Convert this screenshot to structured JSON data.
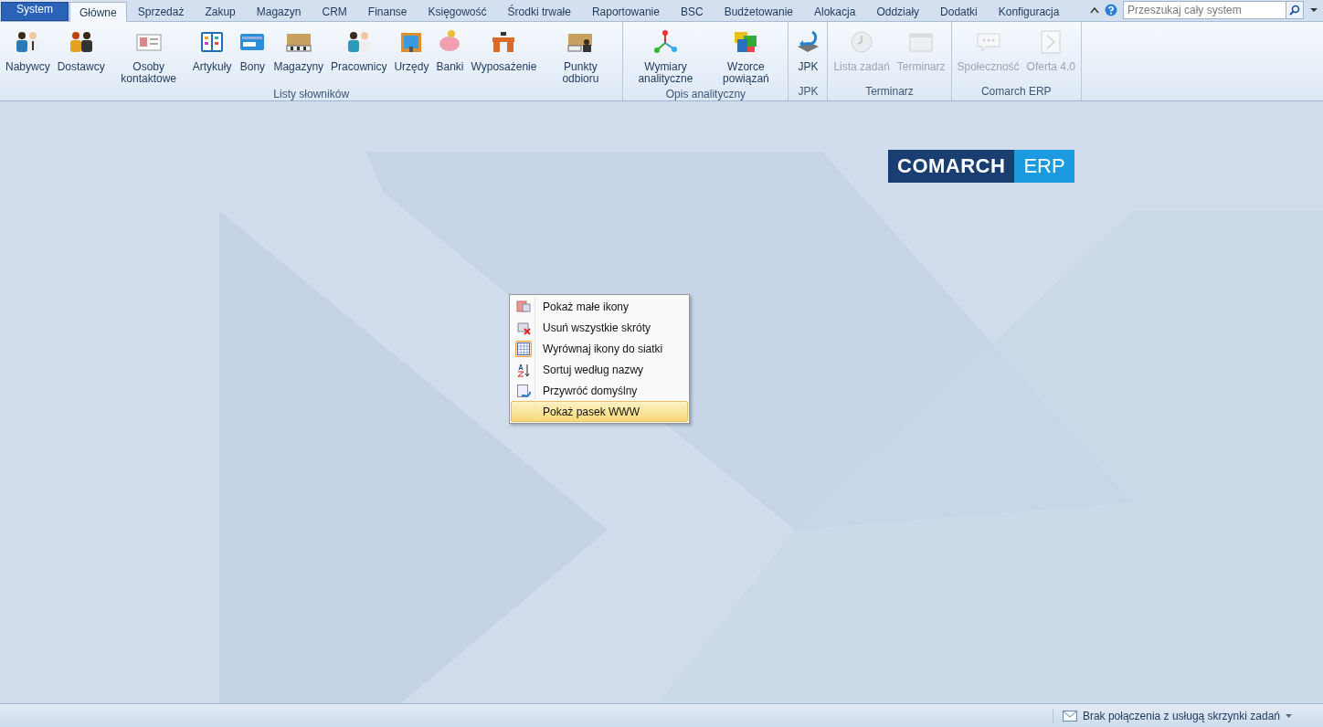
{
  "tabs": [
    {
      "label": "System",
      "kind": "app",
      "selected": false
    },
    {
      "label": "Główne",
      "kind": "tab",
      "selected": true
    },
    {
      "label": "Sprzedaż",
      "kind": "tab",
      "selected": false
    },
    {
      "label": "Zakup",
      "kind": "tab",
      "selected": false
    },
    {
      "label": "Magazyn",
      "kind": "tab",
      "selected": false
    },
    {
      "label": "CRM",
      "kind": "tab",
      "selected": false
    },
    {
      "label": "Finanse",
      "kind": "tab",
      "selected": false
    },
    {
      "label": "Księgowość",
      "kind": "tab",
      "selected": false
    },
    {
      "label": "Środki trwałe",
      "kind": "tab",
      "selected": false
    },
    {
      "label": "Raportowanie",
      "kind": "tab",
      "selected": false
    },
    {
      "label": "BSC",
      "kind": "tab",
      "selected": false
    },
    {
      "label": "Budżetowanie",
      "kind": "tab",
      "selected": false
    },
    {
      "label": "Alokacja",
      "kind": "tab",
      "selected": false
    },
    {
      "label": "Oddziały",
      "kind": "tab",
      "selected": false
    },
    {
      "label": "Dodatki",
      "kind": "tab",
      "selected": false
    },
    {
      "label": "Konfiguracja",
      "kind": "tab",
      "selected": false
    }
  ],
  "search": {
    "placeholder": "Przeszukaj cały system"
  },
  "ribbon_groups": [
    {
      "title": "Listy słowników",
      "buttons": [
        {
          "label": "Nabywcy",
          "disabled": false
        },
        {
          "label": "Dostawcy",
          "disabled": false
        },
        {
          "label": "Osoby kontaktowe",
          "disabled": false
        },
        {
          "label": "Artykuły",
          "disabled": false
        },
        {
          "label": "Bony",
          "disabled": false
        },
        {
          "label": "Magazyny",
          "disabled": false
        },
        {
          "label": "Pracownicy",
          "disabled": false
        },
        {
          "label": "Urzędy",
          "disabled": false
        },
        {
          "label": "Banki",
          "disabled": false
        },
        {
          "label": "Wyposażenie",
          "disabled": false
        },
        {
          "label": "Punkty odbioru",
          "disabled": false
        }
      ]
    },
    {
      "title": "Opis analityczny",
      "buttons": [
        {
          "label": "Wymiary analityczne",
          "disabled": false
        },
        {
          "label": "Wzorce powiązań",
          "disabled": false
        }
      ]
    },
    {
      "title": "JPK",
      "buttons": [
        {
          "label": "JPK",
          "disabled": false
        }
      ]
    },
    {
      "title": "Terminarz",
      "buttons": [
        {
          "label": "Lista zadań",
          "disabled": true
        },
        {
          "label": "Terminarz",
          "disabled": true
        }
      ]
    },
    {
      "title": "Comarch ERP",
      "buttons": [
        {
          "label": "Społeczność",
          "disabled": true
        },
        {
          "label": "Oferta 4.0",
          "disabled": true
        }
      ]
    }
  ],
  "logo": {
    "brand": "COMARCH",
    "product": "ERP"
  },
  "context_menu": [
    {
      "label": "Pokaż małe ikony",
      "checked": false,
      "selected": false
    },
    {
      "label": "Usuń wszystkie skróty",
      "checked": false,
      "selected": false
    },
    {
      "label": "Wyrównaj ikony do siatki",
      "checked": true,
      "selected": false
    },
    {
      "label": "Sortuj według nazwy",
      "checked": false,
      "selected": false
    },
    {
      "label": "Przywróć domyślny",
      "checked": false,
      "selected": false
    },
    {
      "label": "Pokaż pasek WWW",
      "checked": false,
      "selected": true
    }
  ],
  "status_bar": {
    "message": "Brak połączenia z usługą skrzynki zadań"
  }
}
